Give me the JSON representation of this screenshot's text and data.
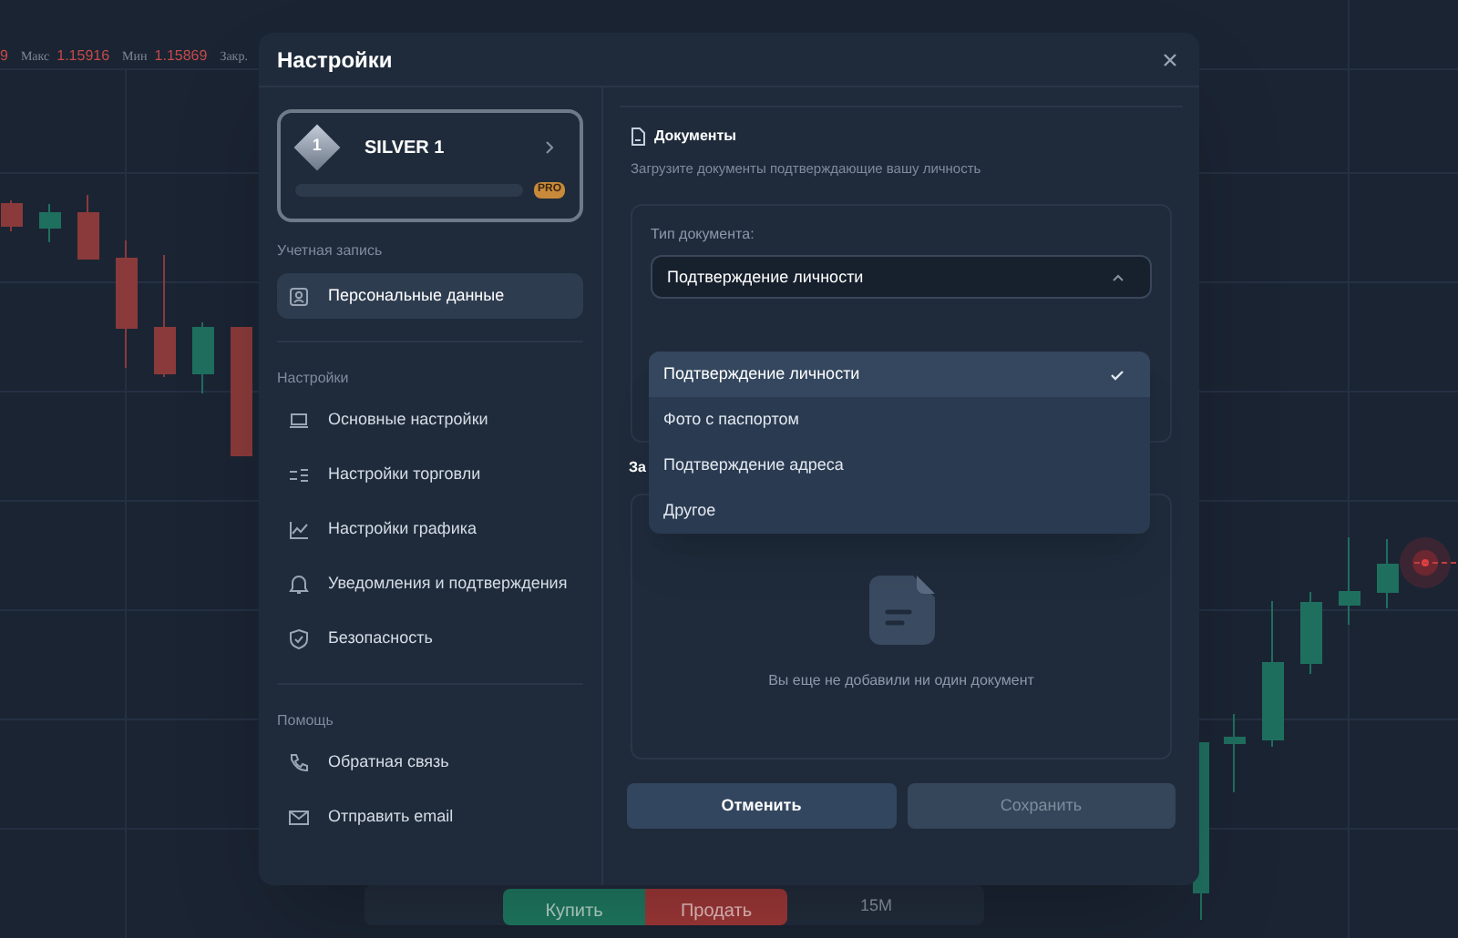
{
  "ticker_stats": [
    {
      "kind": "value",
      "text": "9"
    },
    {
      "kind": "label",
      "text": "Макс"
    },
    {
      "kind": "value",
      "text": "1.15916"
    },
    {
      "kind": "label",
      "text": "Мин"
    },
    {
      "kind": "value",
      "text": "1.15869"
    },
    {
      "kind": "label",
      "text": "Закр."
    }
  ],
  "trade_toolbar": {
    "buy_label": "Купить",
    "sell_label": "Продать",
    "timeframe": "15M"
  },
  "dialog": {
    "title": "Настройки",
    "rank": {
      "number": "1",
      "name": "SILVER 1",
      "badge": "PRO",
      "level": 0
    },
    "sidebar": [
      {
        "heading": "Учетная запись",
        "items": [
          {
            "label": "Персональные данные",
            "selected": true
          }
        ]
      },
      {
        "heading": "Настройки",
        "items": [
          {
            "label": "Основные настройки",
            "selected": false
          },
          {
            "label": "Настройки торговли",
            "selected": false
          },
          {
            "label": "Настройки графика",
            "selected": false
          },
          {
            "label": "Уведомления и подтверждения",
            "selected": false
          },
          {
            "label": "Безопасность",
            "selected": false
          }
        ]
      },
      {
        "heading": "Помощь",
        "items": [
          {
            "label": "Обратная связь",
            "selected": false
          },
          {
            "label": "Отправить email",
            "selected": false
          }
        ]
      }
    ],
    "documents": {
      "title": "Документы",
      "subtitle": "Загрузите документы подтверждающие вашу личность",
      "field_label": "Тип документа:",
      "value": "Подтверждение личности",
      "expanded": true,
      "options": [
        {
          "label": "Подтверждение личности",
          "selected": true
        },
        {
          "label": "Фото с паспортом",
          "selected": false
        },
        {
          "label": "Подтверждение адреса",
          "selected": false
        },
        {
          "label": "Другое",
          "selected": false
        }
      ],
      "upload_heading": "За",
      "empty_text": "Вы еще не добавили ни один документ"
    },
    "buttons": [
      {
        "label": "Отменить",
        "disabled": false
      },
      {
        "label": "Сохранить",
        "disabled": true
      }
    ]
  }
}
